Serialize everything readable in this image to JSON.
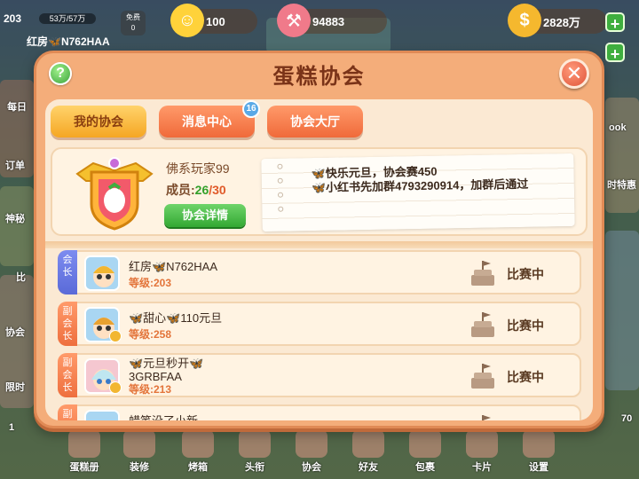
{
  "hud": {
    "level": "203",
    "xp_text": "53万/57万",
    "prop_label": "免费",
    "prop_count": "0",
    "smile_value": "100",
    "hammer_value": "94883",
    "coin_value": "2828万",
    "player_tag": "红房🦋N762HAA",
    "plus_label": "+"
  },
  "side_labels": [
    "每日",
    "订单",
    "神秘",
    "比",
    "协会",
    "限时",
    "1",
    "70"
  ],
  "right_labels": [
    "ook",
    "时特惠"
  ],
  "bottom_nav": [
    "蛋糕册",
    "装修",
    "烤箱",
    "头衔",
    "协会",
    "好友",
    "包裹",
    "卡片",
    "设置"
  ],
  "dialog": {
    "title": "蛋糕协会",
    "help_label": "?",
    "close_label": "✕",
    "tabs": [
      {
        "label": "我的协会",
        "active": true
      },
      {
        "label": "消息中心",
        "badge": "16"
      },
      {
        "label": "协会大厅"
      }
    ],
    "guild": {
      "name": "佛系玩家99",
      "members_label": "成员:",
      "members_current": "26",
      "members_sep": "/",
      "members_max": "30",
      "detail_button": "协会详情",
      "notice": "🦋快乐元旦，协会赛450\n🦋小红书先加群4793290914，加群后通过"
    },
    "members": [
      {
        "role": "会\n长",
        "role_type": "leader",
        "name": "红房🦋N762HAA",
        "level": "等级:203",
        "status": "比赛中"
      },
      {
        "role": "副\n会\n长",
        "role_type": "vice",
        "name": "🦋甜心🦋110元旦",
        "level": "等级:258",
        "status": "比赛中"
      },
      {
        "role": "副\n会\n长",
        "role_type": "vice",
        "name": "🦋元旦秒开🦋\n3GRBFAA",
        "level": "等级:213",
        "status": "比赛中"
      },
      {
        "role": "副",
        "role_type": "vice",
        "name": "蜡笔没了小新",
        "level": "",
        "status": ""
      }
    ]
  },
  "colors": {
    "dialog_bg": "#f4ad7a",
    "panel_bg": "#fbe9d3",
    "tab_active": "#f5a623",
    "tab_inactive": "#f06a3a",
    "green_button": "#33a833",
    "level_text": "#e3743a"
  }
}
